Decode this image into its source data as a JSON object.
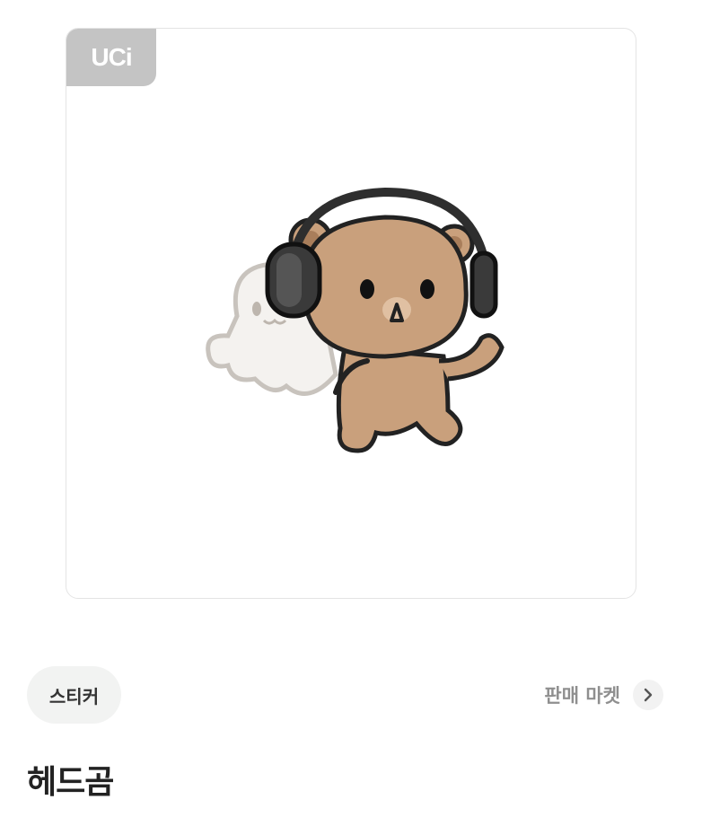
{
  "preview": {
    "badge_label": "UCi",
    "sticker_description_icon": "bear-with-headphones-and-ghost-sticker"
  },
  "category": {
    "label": "스티커"
  },
  "market_link": {
    "label": "판매 마켓",
    "icon": "chevron-right-icon"
  },
  "product": {
    "title": "헤드곰"
  },
  "colors": {
    "chip_bg": "#f2f3f2",
    "badge_bg": "#c4c4c4",
    "bear_fill": "#c9a07c",
    "headphone": "#3a3a3a"
  }
}
